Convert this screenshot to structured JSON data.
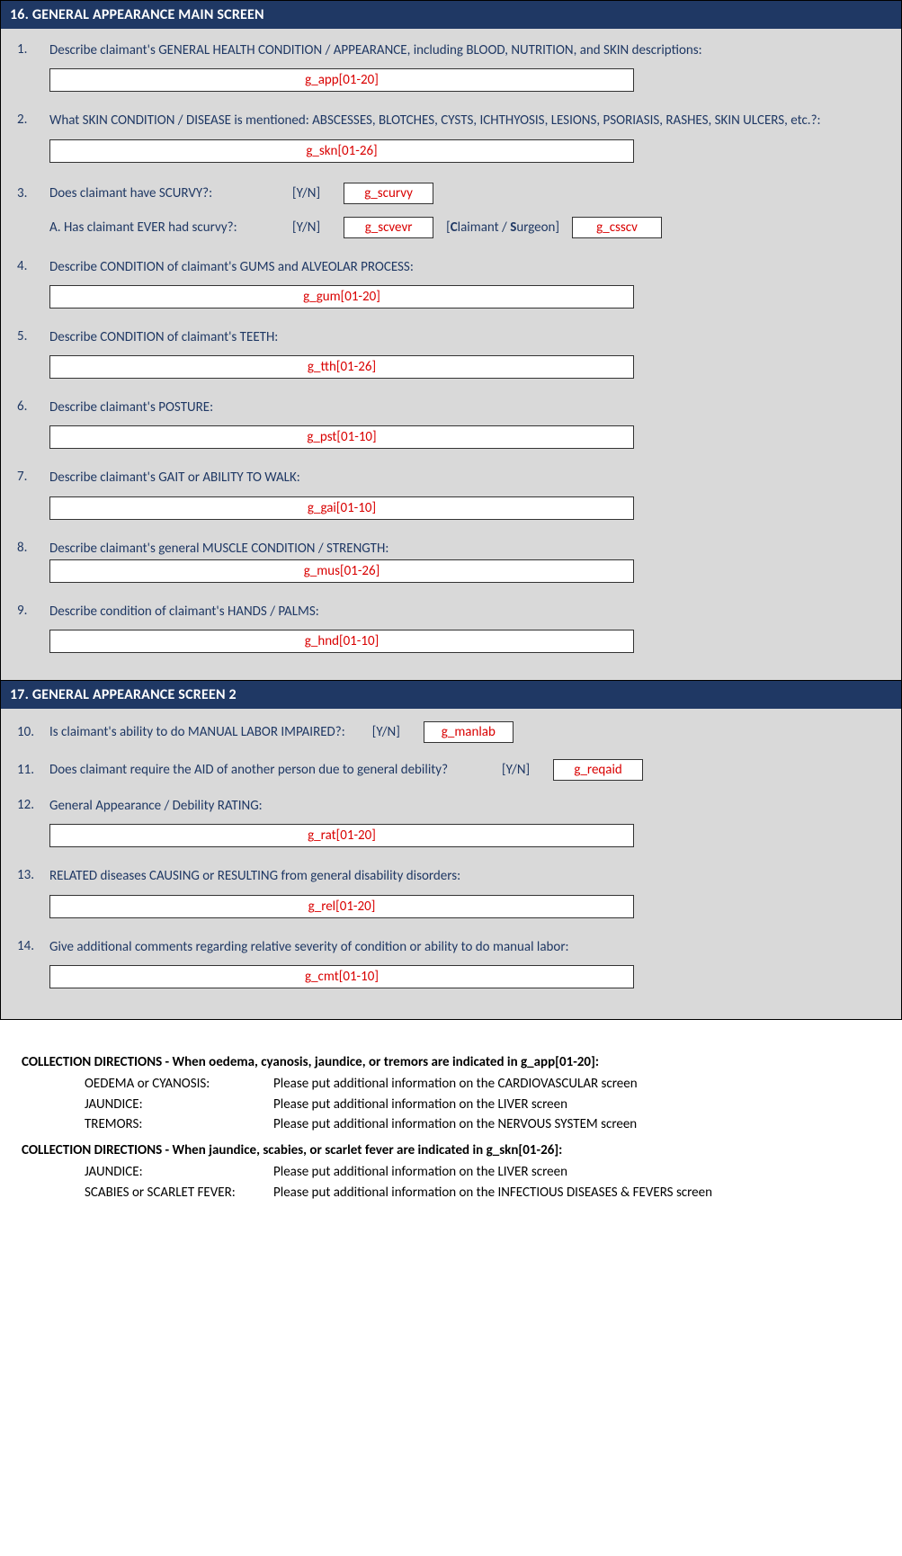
{
  "section16": {
    "header": "16. GENERAL APPEARANCE MAIN SCREEN",
    "q1": {
      "num": "1.",
      "text": "Describe claimant's GENERAL HEALTH CONDITION / APPEARANCE, including BLOOD, NUTRITION, and SKIN descriptions:",
      "field": "g_app[01-20]"
    },
    "q2": {
      "num": "2.",
      "text": "What SKIN CONDITION / DISEASE is mentioned: ABSCESSES, BLOTCHES, CYSTS, ICHTHYOSIS, LESIONS, PSORIASIS, RASHES, SKIN ULCERS, etc.?:",
      "field": "g_skn[01-26]"
    },
    "q3": {
      "num": "3.",
      "text": "Does claimant have SCURVY?:",
      "yn": "[Y/N]",
      "field": "g_scurvy",
      "sub_label": "A. Has claimant EVER had scurvy?:",
      "sub_yn": "[Y/N]",
      "sub_field1": "g_scvevr",
      "cs_label": "[Claimant / Surgeon]",
      "sub_field2": "g_csscv"
    },
    "q4": {
      "num": "4.",
      "text": "Describe CONDITION of claimant's GUMS and ALVEOLAR PROCESS:",
      "field": "g_gum[01-20]"
    },
    "q5": {
      "num": "5.",
      "text": "Describe CONDITION of claimant's TEETH:",
      "field": "g_tth[01-26]"
    },
    "q6": {
      "num": "6.",
      "text": "Describe claimant's POSTURE:",
      "field": "g_pst[01-10]"
    },
    "q7": {
      "num": "7.",
      "text": "Describe claimant's GAIT or ABILITY TO WALK:",
      "field": "g_gai[01-10]"
    },
    "q8": {
      "num": "8.",
      "text": "Describe claimant's general MUSCLE CONDITION / STRENGTH:",
      "field": "g_mus[01-26]"
    },
    "q9": {
      "num": "9.",
      "text": "Describe condition of claimant's HANDS / PALMS:",
      "field": "g_hnd[01-10]"
    }
  },
  "section17": {
    "header": "17. GENERAL APPEARANCE SCREEN 2",
    "q10": {
      "num": "10.",
      "text": "Is claimant's ability to do MANUAL LABOR IMPAIRED?:",
      "yn": "[Y/N]",
      "field": "g_manlab"
    },
    "q11": {
      "num": "11.",
      "text": "Does claimant require the AID of another person due to general debility?",
      "yn": "[Y/N]",
      "field": "g_reqaid"
    },
    "q12": {
      "num": "12.",
      "text": "General Appearance / Debility RATING:",
      "field": "g_rat[01-20]"
    },
    "q13": {
      "num": "13.",
      "text": "RELATED diseases CAUSING or RESULTING from general disability disorders:",
      "field": "g_rel[01-20]"
    },
    "q14": {
      "num": "14.",
      "text": "Give additional comments regarding relative severity of condition or ability to do manual labor:",
      "field": "g_cmt[01-10]"
    }
  },
  "directions": {
    "head1": "COLLECTION DIRECTIONS - When oedema, cyanosis, jaundice, or tremors are indicated in g_app[01-20]:",
    "rows1": [
      {
        "k": "OEDEMA or CYANOSIS:",
        "v": "Please put additional information on the CARDIOVASCULAR screen"
      },
      {
        "k": "JAUNDICE:",
        "v": "Please put additional information on the LIVER screen"
      },
      {
        "k": "TREMORS:",
        "v": "Please put additional information on the NERVOUS SYSTEM screen"
      }
    ],
    "head2": "COLLECTION DIRECTIONS - When jaundice, scabies, or scarlet fever are indicated in g_skn[01-26]:",
    "rows2": [
      {
        "k": "JAUNDICE:",
        "v": "Please put additional information on the LIVER screen"
      },
      {
        "k": "SCABIES or SCARLET FEVER:",
        "v": "Please put additional information on the INFECTIOUS DISEASES & FEVERS screen"
      }
    ]
  }
}
